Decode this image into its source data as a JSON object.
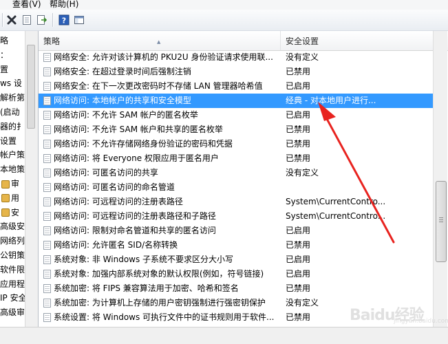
{
  "menu": {
    "view": "查看(V)",
    "help": "帮助(H)"
  },
  "toolbar": {
    "icons": [
      "delete-icon",
      "properties-icon",
      "export-list-icon",
      "help-icon",
      "show-hide-pane-icon"
    ]
  },
  "left_tree": {
    "items": [
      {
        "label": "略"
      },
      {
        "label": "："
      },
      {
        "label": "置"
      },
      {
        "label": "ws 设"
      },
      {
        "label": "解析第"
      },
      {
        "label": "(启动"
      },
      {
        "label": "器的扌"
      },
      {
        "label": "设置"
      },
      {
        "label": "帐户策"
      },
      {
        "label": "本地策"
      },
      {
        "label": "审"
      },
      {
        "label": "用"
      },
      {
        "label": "安"
      },
      {
        "label": "高级安"
      },
      {
        "label": "网络列"
      },
      {
        "label": "公钥策"
      },
      {
        "label": "软件限"
      },
      {
        "label": "应用程"
      },
      {
        "label": "IP 安全"
      },
      {
        "label": "高级审"
      }
    ]
  },
  "list": {
    "headers": {
      "policy": "策略",
      "setting": "安全设置"
    },
    "rows": [
      {
        "name": "网络安全: 允许对该计算机的 PKU2U 身份验证请求使用联...",
        "value": "没有定义"
      },
      {
        "name": "网络安全: 在超过登录时间后强制注销",
        "value": "已禁用"
      },
      {
        "name": "网络安全: 在下一次更改密码时不存储 LAN 管理器哈希值",
        "value": "已启用"
      },
      {
        "name": "网络访问: 本地帐户的共享和安全模型",
        "value": "经典 - 对本地用户进行..."
      },
      {
        "name": "网络访问: 不允许 SAM 帐户的匿名枚举",
        "value": "已启用"
      },
      {
        "name": "网络访问: 不允许 SAM 帐户和共享的匿名枚举",
        "value": "已禁用"
      },
      {
        "name": "网络访问: 不允许存储网络身份验证的密码和凭据",
        "value": "已禁用"
      },
      {
        "name": "网络访问: 将 Everyone 权限应用于匿名用户",
        "value": "已禁用"
      },
      {
        "name": "网络访问: 可匿名访问的共享",
        "value": "没有定义"
      },
      {
        "name": "网络访问: 可匿名访问的命名管道",
        "value": ""
      },
      {
        "name": "网络访问: 可远程访问的注册表路径",
        "value": "System\\CurrentContro..."
      },
      {
        "name": "网络访问: 可远程访问的注册表路径和子路径",
        "value": "System\\CurrentContro..."
      },
      {
        "name": "网络访问: 限制对命名管道和共享的匿名访问",
        "value": "已启用"
      },
      {
        "name": "网络访问: 允许匿名 SID/名称转换",
        "value": "已禁用"
      },
      {
        "name": "系统对象: 非 Windows 子系统不要求区分大小写",
        "value": "已启用"
      },
      {
        "name": "系统对象: 加强内部系统对象的默认权限(例如，符号链接)",
        "value": "已启用"
      },
      {
        "name": "系统加密: 将 FIPS 兼容算法用于加密、哈希和签名",
        "value": "已禁用"
      },
      {
        "name": "系统加密: 为计算机上存储的用户密钥强制进行强密钥保护",
        "value": "没有定义"
      },
      {
        "name": "系统设置: 将 Windows 可执行文件中的证书规则用于软件...",
        "value": "已禁用"
      }
    ],
    "selected_index": 3
  },
  "colors": {
    "selection": "#3399ff",
    "arrow": "#e8231f"
  },
  "watermark": {
    "brand": "Baidu经验",
    "sub": "jingyan.baidu.com"
  }
}
